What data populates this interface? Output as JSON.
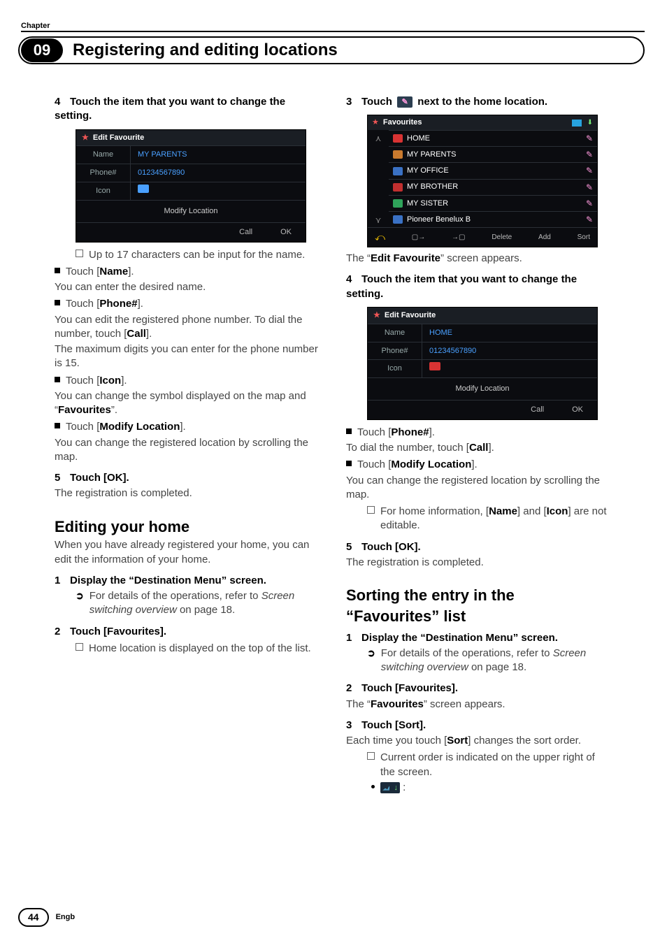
{
  "header": {
    "chapter_label": "Chapter",
    "chapter_number": "09",
    "title": "Registering and editing locations"
  },
  "col1": {
    "step4": "Touch the item that you want to change the setting.",
    "ss1": {
      "title": "Edit Favourite",
      "name_label": "Name",
      "name_value": "MY PARENTS",
      "phone_label": "Phone#",
      "phone_value": "01234567890",
      "icon_label": "Icon",
      "modify": "Modify Location",
      "call": "Call",
      "ok": "OK"
    },
    "note_17": "Up to 17 characters can be input for the name.",
    "touch_name": "Touch [",
    "touch_name_b": "Name",
    "touch_name_end": "].",
    "name_desc": "You can enter the desired name.",
    "touch_phone": "Touch [",
    "touch_phone_b": "Phone#",
    "touch_phone_end": "].",
    "phone_desc1": "You can edit the registered phone number. To dial the number, touch [",
    "phone_desc1_b": "Call",
    "phone_desc1_end": "].",
    "phone_desc2": "The maximum digits you can enter for the phone number is 15.",
    "touch_icon": "Touch [",
    "touch_icon_b": "Icon",
    "touch_icon_end": "].",
    "icon_desc": "You can change the symbol displayed on the map and “",
    "icon_desc_b": "Favourites",
    "icon_desc_end": "”.",
    "touch_modify": "Touch [",
    "touch_modify_b": "Modify Location",
    "touch_modify_end": "].",
    "modify_desc": "You can change the registered location by scrolling the map.",
    "step5": "Touch [OK].",
    "step5_body": "The registration is completed.",
    "h2_edit_home": "Editing your home",
    "edit_home_intro": "When you have already registered your home, you can edit the information of your home.",
    "step1_dest": "Display the “Destination Menu” screen.",
    "ref_text1": "For details of the operations, refer to ",
    "ref_text_i": "Screen switching overview",
    "ref_text_end": " on page 18.",
    "step2_fav": "Touch [Favourites].",
    "note_home_top": "Home location is displayed on the top of the list."
  },
  "col2": {
    "step3": "Touch ",
    "step3_end": " next to the home location.",
    "fav": {
      "title": "Favourites",
      "rows": [
        {
          "name": "HOME",
          "color": "#d83333"
        },
        {
          "name": "MY PARENTS",
          "color": "#c97a2e"
        },
        {
          "name": "MY OFFICE",
          "color": "#3a71c4"
        },
        {
          "name": "MY BROTHER",
          "color": "#c12f2f"
        },
        {
          "name": "MY SISTER",
          "color": "#2fa35a"
        },
        {
          "name": "Pioneer Benelux B",
          "color": "#3a71c4"
        }
      ],
      "bottom": {
        "delete": "Delete",
        "add": "Add",
        "sort": "Sort"
      }
    },
    "fav_screen_appears": "The “",
    "fav_screen_appears_b": "Edit Favourite",
    "fav_screen_appears_end": "” screen appears.",
    "step4": "Touch the item that you want to change the setting.",
    "ss2": {
      "title": "Edit Favourite",
      "name_label": "Name",
      "name_value": "HOME",
      "phone_label": "Phone#",
      "phone_value": "01234567890",
      "icon_label": "Icon",
      "modify": "Modify Location",
      "call": "Call",
      "ok": "OK"
    },
    "touch_phone": "Touch [",
    "touch_phone_b": "Phone#",
    "touch_phone_end": "].",
    "dial_desc": "To dial the number, touch [",
    "dial_desc_b": "Call",
    "dial_desc_end": "].",
    "touch_modify": "Touch [",
    "touch_modify_b": "Modify Location",
    "touch_modify_end": "].",
    "modify_desc": "You can change the registered location by scrolling the map.",
    "home_info_note": "For home information, [",
    "home_info_note_b1": "Name",
    "home_info_note_mid": "] and [",
    "home_info_note_b2": "Icon",
    "home_info_note_end": "] are not editable.",
    "step5": "Touch [OK].",
    "step5_body": "The registration is completed.",
    "h2_sort": "Sorting the entry in the “Favourites” list",
    "step1_dest": "Display the “Destination Menu” screen.",
    "ref_text1": "For details of the operations, refer to ",
    "ref_text_i": "Screen switching overview",
    "ref_text_end": " on page 18.",
    "step2_fav": "Touch [Favourites].",
    "fav_screen2": "The “",
    "fav_screen2_b": "Favourites",
    "fav_screen2_end": "” screen appears.",
    "step3_sort": "Touch [Sort].",
    "sort_desc": "Each time you touch [",
    "sort_desc_b": "Sort",
    "sort_desc_end": "] changes the sort order.",
    "sort_note": "Current order is indicated on the upper right of the screen.",
    "colon": ":"
  },
  "footer": {
    "page": "44",
    "lang": "Engb"
  }
}
